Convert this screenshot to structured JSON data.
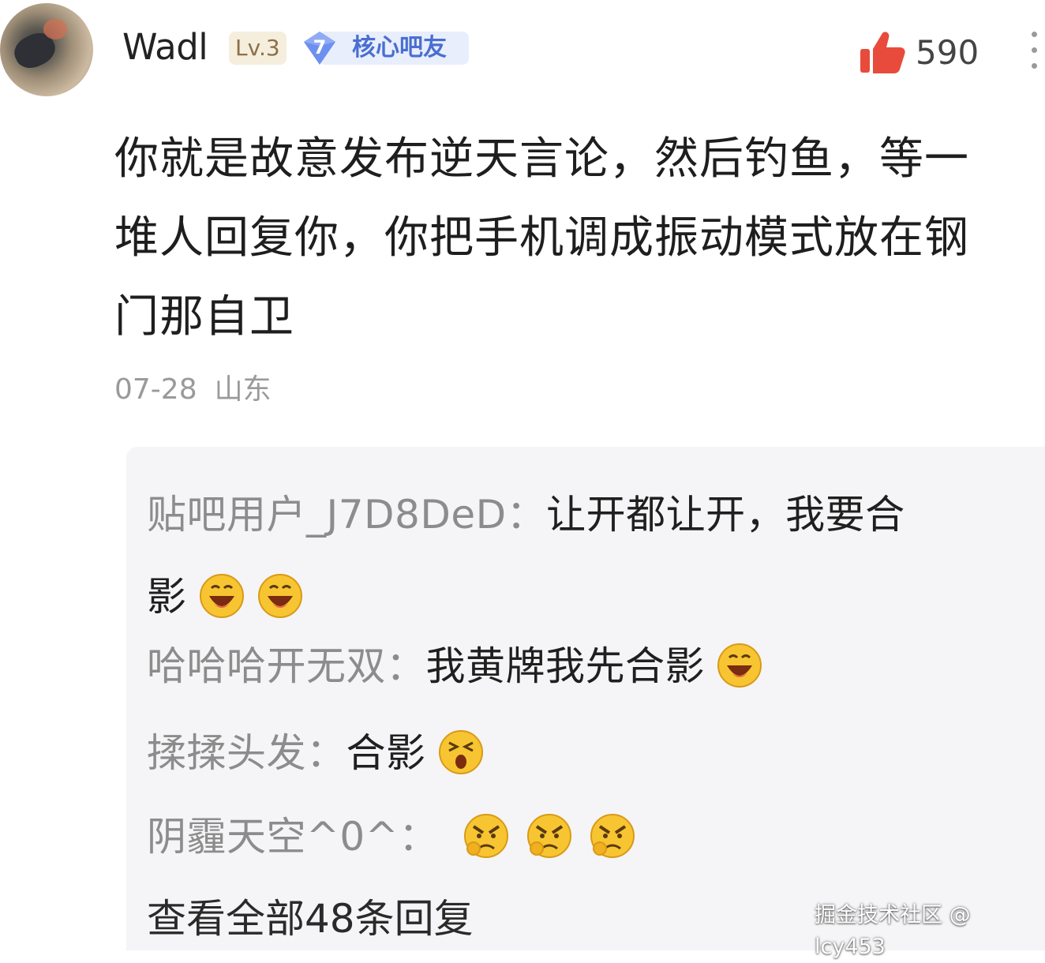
{
  "post": {
    "username": "Wadl",
    "level_badge": "Lv.3",
    "member_level": "7",
    "member_title": "核心吧友",
    "like_count": "590",
    "content_lines": [
      "你就是故意发布逆天言论，然后钓鱼，等一",
      "堆人回复你，你把手机调成振动模式放在钢",
      "门那自卫"
    ],
    "date": "07-28",
    "location": "山东"
  },
  "replies": [
    {
      "author": "贴吧用户_J7D8DeD：",
      "text_line1": "让开都让开，我要合",
      "text_line2": "影",
      "emojis": [
        "laugh-emoji",
        "laugh-emoji"
      ]
    },
    {
      "author": "哈哈哈开无双：",
      "text": "我黄牌我先合影",
      "emojis": [
        "laugh-emoji"
      ]
    },
    {
      "author": "揉揉头发：",
      "text": "合影",
      "emojis": [
        "squint-emoji"
      ]
    },
    {
      "author": "阴霾天空^0^：",
      "text": "",
      "emojis": [
        "angry-emoji",
        "angry-emoji",
        "angry-emoji"
      ]
    }
  ],
  "view_all_replies": "查看全部48条回复",
  "watermark": "掘金技术社区 @ lcy453",
  "colors": {
    "like_red": "#e84b3c",
    "member_blue": "#4a6ed1",
    "reply_bg": "#f5f5f7",
    "meta_gray": "#9a9a9a",
    "emoji_yellow": "#f7c531"
  }
}
